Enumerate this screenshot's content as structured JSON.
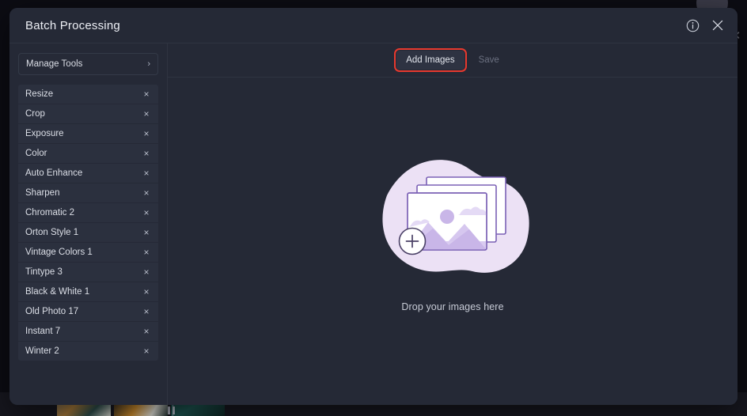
{
  "window": {
    "background_color": "#0c0c13"
  },
  "modal": {
    "title": "Batch Processing",
    "background_color": "#252936",
    "header_icons": [
      {
        "name": "info-icon",
        "label": "Info"
      },
      {
        "name": "close-icon",
        "label": "Close"
      }
    ]
  },
  "sidebar": {
    "manage_tools": {
      "label": "Manage Tools",
      "chevron": "›"
    },
    "remove_glyph": "×",
    "tools": [
      {
        "label": "Resize"
      },
      {
        "label": "Crop"
      },
      {
        "label": "Exposure"
      },
      {
        "label": "Color"
      },
      {
        "label": "Auto Enhance"
      },
      {
        "label": "Sharpen"
      },
      {
        "label": "Chromatic 2"
      },
      {
        "label": "Orton Style 1"
      },
      {
        "label": "Vintage Colors 1"
      },
      {
        "label": "Tintype 3"
      },
      {
        "label": "Black & White 1"
      },
      {
        "label": "Old Photo 17"
      },
      {
        "label": "Instant 7"
      },
      {
        "label": "Winter 2"
      }
    ]
  },
  "toolbar": {
    "add_images_label": "Add Images",
    "save_label": "Save",
    "save_enabled": false,
    "highlight_color": "#e8392e",
    "highlighted_button": "Add Images"
  },
  "dropzone": {
    "message": "Drop your images here",
    "illustration": {
      "name": "stacked-images-with-plus",
      "blob_color": "#ece1f5",
      "card_fill": "#ffffff",
      "card_stroke": "#7b61b5",
      "scene_color": "#c9b6e8",
      "scene_color_light": "#e4daf5",
      "plus_circle_fill": "#ffffff",
      "plus_circle_stroke": "#4a4066"
    }
  },
  "background": {
    "filmstrip_visible": true,
    "thumbnails": [
      "thumb-1",
      "thumb-2",
      "thumb-3"
    ],
    "playhead_visible": true
  }
}
